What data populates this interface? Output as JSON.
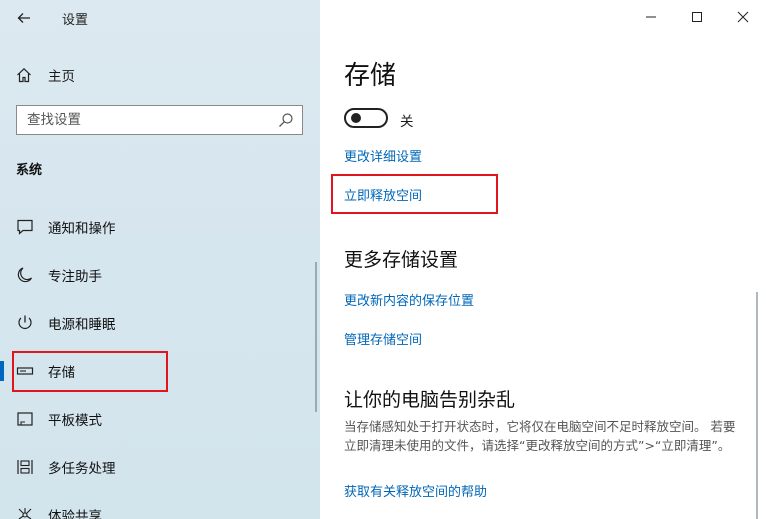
{
  "app": {
    "title": "设置"
  },
  "sidebar": {
    "home_label": "主页",
    "search": {
      "placeholder": "查找设置"
    },
    "section_label": "系统",
    "items": [
      {
        "label": "通知和操作",
        "icon": "notification-icon"
      },
      {
        "label": "专注助手",
        "icon": "moon-icon"
      },
      {
        "label": "电源和睡眠",
        "icon": "power-icon"
      },
      {
        "label": "存储",
        "icon": "storage-icon",
        "active": true
      },
      {
        "label": "平板模式",
        "icon": "tablet-icon"
      },
      {
        "label": "多任务处理",
        "icon": "multitasking-icon"
      },
      {
        "label": "体验共享",
        "icon": "share-icon"
      }
    ]
  },
  "content": {
    "title": "存储",
    "toggle": {
      "state_label": "关",
      "on": false
    },
    "links": {
      "change_details": "更改详细设置",
      "free_space": "立即释放空间"
    },
    "more_section": {
      "title": "更多存储设置",
      "links": [
        "更改新内容的保存位置",
        "管理存储空间"
      ]
    },
    "declutter_section": {
      "title": "让你的电脑告别杂乱",
      "description": "当存储感知处于打开状态时，它将仅在电脑空间不足时释放空间。 若要立即清理未使用的文件，请选择“更改释放空间的方式”>“立即清理”。",
      "help_link": "获取有关释放空间的帮助"
    }
  },
  "colors": {
    "accent": "#0067c0",
    "link": "#0067b8",
    "highlight_box": "#e0161e"
  }
}
